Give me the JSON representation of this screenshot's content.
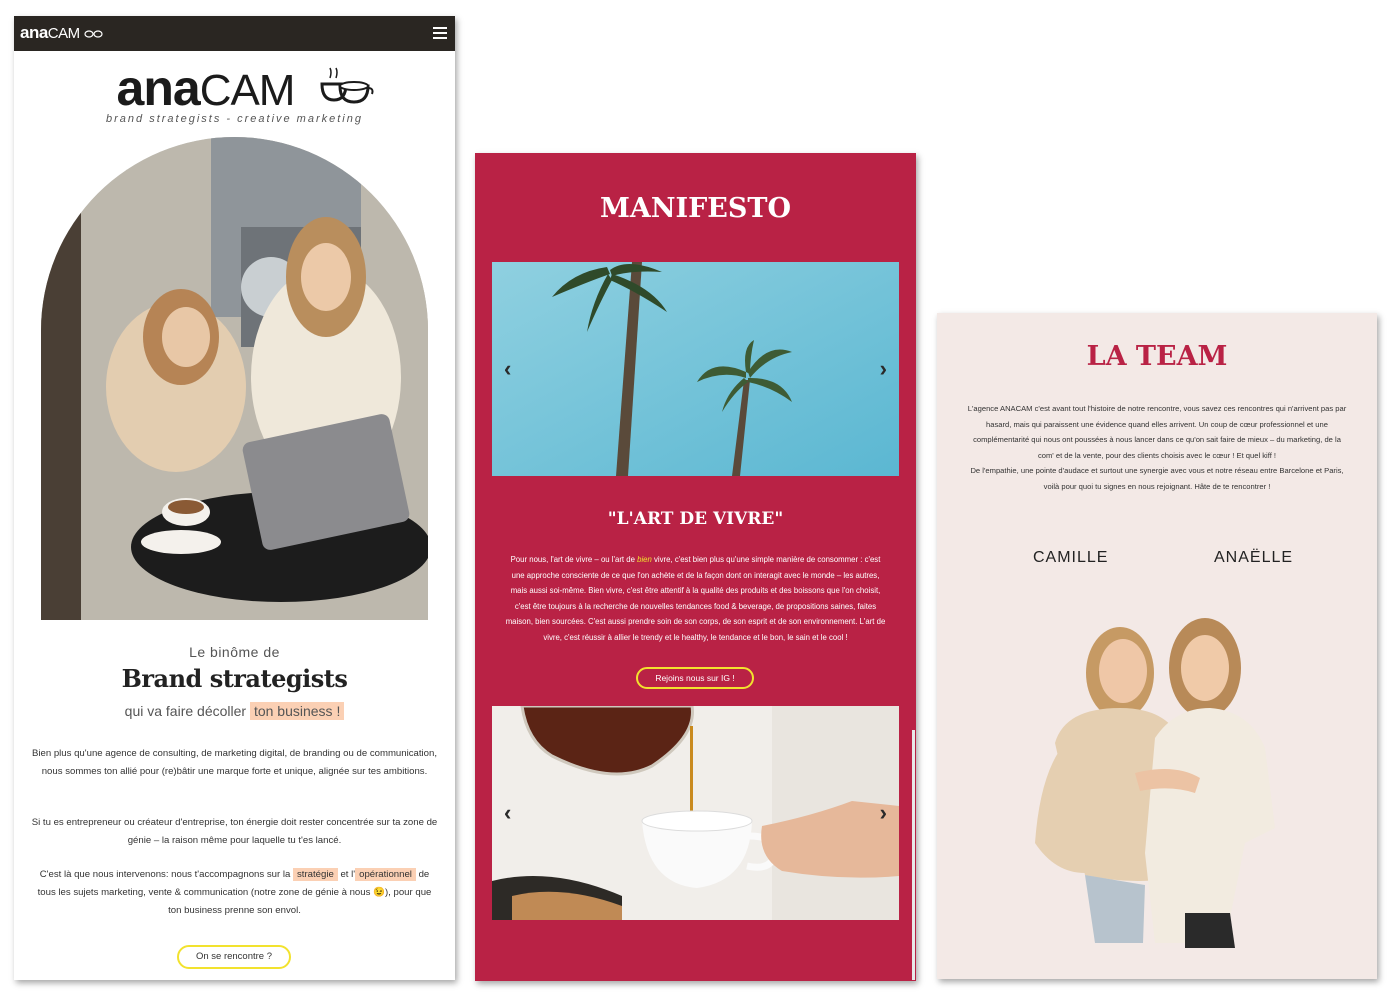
{
  "panel_home": {
    "nav_logo_bold": "ana",
    "nav_logo_thin": "CAM",
    "logo_bold": "ana",
    "logo_thin": "CAM",
    "logo_tagline": "brand strategists - creative marketing",
    "intro_small": "Le binôme de",
    "intro_big": "Brand strategists",
    "intro_sub_prefix": "qui va faire décoller",
    "intro_sub_highlight": "ton business !",
    "paragraph_1": "Bien plus qu'une agence de consulting, de marketing digital, de branding ou de communication, nous sommes ton allié pour (re)bâtir une marque forte et unique, alignée sur tes ambitions.",
    "paragraph_2": "Si tu es entrepreneur ou créateur d'entreprise, ton énergie doit rester concentrée sur ta zone de génie – la raison même pour laquelle tu t'es lancé.",
    "paragraph_3_a": "C'est là que nous intervenons: nous t'accompagnons sur la",
    "paragraph_3_hl1": "stratégie",
    "paragraph_3_b": "et l'",
    "paragraph_3_hl2": "opérationnel",
    "paragraph_3_c": "de tous les sujets marketing, vente & communication (notre zone de génie à nous 😉), pour que ton business prenne son envol.",
    "cta_label": "On se rencontre ?"
  },
  "panel_manifesto": {
    "title": "MANIFESTO",
    "subtitle": "\"L'ART DE VIVRE\"",
    "text_a": "Pour nous, l'art de vivre – ou l'art de",
    "text_em": "bien",
    "text_b": "vivre, c'est bien plus qu'une simple manière de consommer : c'est une approche consciente de ce que l'on achète et de la façon dont on interagit avec le monde – les autres, mais aussi soi-même. Bien vivre, c'est être attentif à la qualité des produits et des boissons que l'on choisit, c'est être toujours à la recherche de nouvelles tendances food & beverage, de propositions saines, faites maison, bien sourcées. C'est aussi prendre soin de son corps, de son esprit et de son environnement. L'art de vivre, c'est réussir à allier le trendy et le healthy, le tendance et le bon, le sain et le cool !",
    "cta_label": "Rejoins nous sur IG !",
    "arrow_left": "‹",
    "arrow_right": "›"
  },
  "panel_team": {
    "title": "LA TEAM",
    "text": "L'agence ANACAM c'est avant tout l'histoire de notre rencontre, vous savez ces rencontres qui n'arrivent pas par hasard, mais qui paraissent une évidence quand elles arrivent. Un coup de cœur professionnel et une complémentarité qui nous ont poussées à nous lancer dans ce qu'on sait faire de mieux – du marketing, de la com' et de la vente, pour des clients choisis avec le cœur ! Et quel kiff !",
    "text_2": "De l'empathie, une pointe d'audace et surtout une synergie avec vous et notre réseau entre Barcelone et Paris, voilà pour quoi tu signes en nous rejoignant. Hâte de te rencontrer !",
    "name_1": "CAMILLE",
    "name_2": "ANAËLLE"
  },
  "colors": {
    "brand_red": "#b92245",
    "accent_yellow": "#f2e22e",
    "highlight_peach": "#fbd0b4",
    "team_bg": "#f3e9e6",
    "nav_dark": "#2a2622"
  },
  "icons": [
    "hamburger-menu-icon",
    "coffee-cups-logo-icon",
    "chevron-left-icon",
    "chevron-right-icon"
  ]
}
